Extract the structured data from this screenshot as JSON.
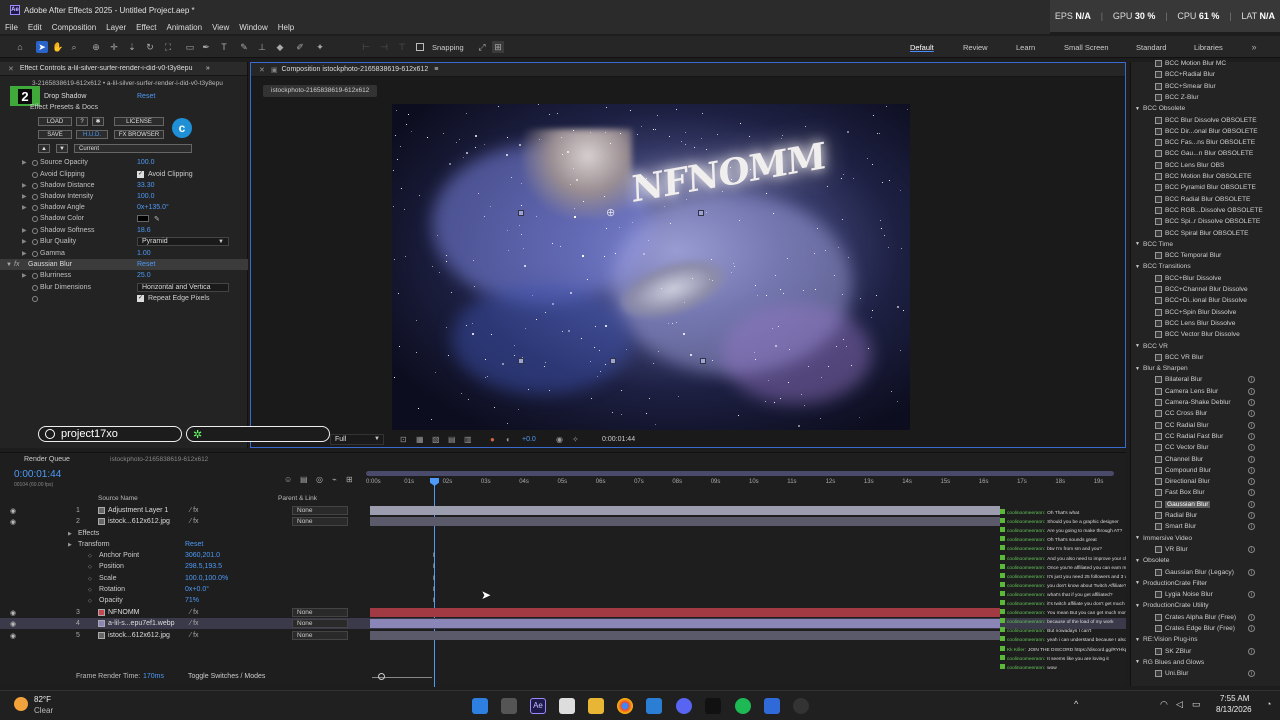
{
  "app": {
    "logo": "Ae",
    "title": "Adobe After Effects 2025 - Untitled Project.aep *",
    "stats": {
      "fps_label": "EPS",
      "fps_value": "N/A",
      "gpu_label": "GPU",
      "gpu_value": "30 %",
      "cpu_label": "CPU",
      "cpu_value": "61 %",
      "lat_label": "LAT",
      "lat_value": "N/A"
    }
  },
  "menu": [
    "File",
    "Edit",
    "Composition",
    "Layer",
    "Effect",
    "Animation",
    "View",
    "Window",
    "Help"
  ],
  "toolbar": {
    "snapping_label": "Snapping",
    "workspaces": [
      "Default",
      "Review",
      "Learn",
      "Small Screen",
      "Standard",
      "Libraries"
    ],
    "active_workspace": "Default"
  },
  "effect_controls": {
    "tab_title": "Effect Controls a-lil-silver-surfer-render-i-did-v0-t3y8epu",
    "subtitle": "a-lil-silver-surfer-render-i-did-v0-t3y8epu",
    "layer_ref": "3-2165838619-612x612 • a-lil-silver-surfer-render-i-did-v0-t3y8epu",
    "badge": "2",
    "drop_shadow": "Drop Shadow",
    "reset": "Reset",
    "presets": "Effect Presets & Docs",
    "buttons": {
      "load": "LOAD",
      "help": "?",
      "license": "LICENSE",
      "save": "SAVE",
      "hud": "H.U.D.",
      "browser": "FX BROWSER",
      "current": "Current"
    },
    "properties": [
      {
        "name": "Source Opacity",
        "value": "100.0"
      },
      {
        "name": "Avoid Clipping",
        "value": "Avoid Clipping"
      },
      {
        "name": "Shadow Distance",
        "value": "33.30"
      },
      {
        "name": "Shadow Intensity",
        "value": "100.0"
      },
      {
        "name": "Shadow Angle",
        "value": "0x+135.0°"
      },
      {
        "name": "Shadow Color",
        "value": ""
      },
      {
        "name": "Shadow Softness",
        "value": "18.6"
      },
      {
        "name": "Blur Quality",
        "value": "Pyramid"
      },
      {
        "name": "Gamma",
        "value": "1.00"
      }
    ],
    "gaussian": {
      "name": "Gaussian Blur",
      "reset": "Reset",
      "blurriness_label": "Blurriness",
      "blurriness": "25.0",
      "dimensions_label": "Blur Dimensions",
      "dimensions": "Horizontal and Vertica",
      "repeat": "Repeat Edge Pixels"
    }
  },
  "composition": {
    "tab_title": "Composition istockphoto-2165838619-612x612",
    "sub_tab": "istockphoto-2165838619-612x612",
    "viewer_text": "NFNOMM",
    "zoom": "Full",
    "timecode": "0:00:01:44",
    "exposure": "+0.0"
  },
  "stream_overlay": {
    "handle": "project17xo"
  },
  "fx_browser": [
    {
      "label": "BCC Motion Blur MC",
      "kind": "item"
    },
    {
      "label": "BCC+Radial Blur",
      "kind": "item"
    },
    {
      "label": "BCC+Smear Blur",
      "kind": "item"
    },
    {
      "label": "BCC Z-Blur",
      "kind": "item"
    },
    {
      "label": "BCC Obsolete",
      "kind": "cat"
    },
    {
      "label": "BCC Blur Dissolve OBSOLETE",
      "kind": "item"
    },
    {
      "label": "BCC Dir...onal Blur OBSOLETE",
      "kind": "item"
    },
    {
      "label": "BCC Fas...ns Blur OBSOLETE",
      "kind": "item"
    },
    {
      "label": "BCC Gau...n Blur OBSOLETE",
      "kind": "item"
    },
    {
      "label": "BCC Lens Blur OBS",
      "kind": "item"
    },
    {
      "label": "BCC Motion Blur OBSOLETE",
      "kind": "item"
    },
    {
      "label": "BCC Pyramid Blur OBSOLETE",
      "kind": "item"
    },
    {
      "label": "BCC Radial Blur OBSOLETE",
      "kind": "item"
    },
    {
      "label": "BCC RGB...Dissolve OBSOLETE",
      "kind": "item"
    },
    {
      "label": "BCC Spi..r Dissolve OBSOLETE",
      "kind": "item"
    },
    {
      "label": "BCC Spiral Blur OBSOLETE",
      "kind": "item"
    },
    {
      "label": "BCC Time",
      "kind": "cat"
    },
    {
      "label": "BCC Temporal Blur",
      "kind": "item"
    },
    {
      "label": "BCC Transitions",
      "kind": "cat"
    },
    {
      "label": "BCC+Blur Dissolve",
      "kind": "item"
    },
    {
      "label": "BCC+Channel Blur Dissolve",
      "kind": "item"
    },
    {
      "label": "BCC+Di..ional Blur Dissolve",
      "kind": "item"
    },
    {
      "label": "BCC+Spin Blur Dissolve",
      "kind": "item"
    },
    {
      "label": "BCC Lens Blur Dissolve",
      "kind": "item"
    },
    {
      "label": "BCC Vector Blur Dissolve",
      "kind": "item"
    },
    {
      "label": "BCC VR",
      "kind": "cat"
    },
    {
      "label": "BCC VR Blur",
      "kind": "item"
    },
    {
      "label": "Blur & Sharpen",
      "kind": "cat"
    },
    {
      "label": "Bilateral Blur",
      "kind": "item"
    },
    {
      "label": "Camera Lens Blur",
      "kind": "item"
    },
    {
      "label": "Camera-Shake Deblur",
      "kind": "item"
    },
    {
      "label": "CC Cross Blur",
      "kind": "item"
    },
    {
      "label": "CC Radial Blur",
      "kind": "item"
    },
    {
      "label": "CC Radial Fast Blur",
      "kind": "item"
    },
    {
      "label": "CC Vector Blur",
      "kind": "item"
    },
    {
      "label": "Channel Blur",
      "kind": "item"
    },
    {
      "label": "Compound Blur",
      "kind": "item"
    },
    {
      "label": "Directional Blur",
      "kind": "item"
    },
    {
      "label": "Fast Box Blur",
      "kind": "item"
    },
    {
      "label": "Gaussian Blur",
      "kind": "sel"
    },
    {
      "label": "Radial Blur",
      "kind": "item"
    },
    {
      "label": "Smart Blur",
      "kind": "item"
    },
    {
      "label": "Immersive Video",
      "kind": "cat"
    },
    {
      "label": "VR Blur",
      "kind": "item"
    },
    {
      "label": "Obsolete",
      "kind": "cat"
    },
    {
      "label": "Gaussian Blur (Legacy)",
      "kind": "item"
    },
    {
      "label": "ProductionCrate Filter",
      "kind": "cat"
    },
    {
      "label": "Lygia Noise Blur",
      "kind": "item"
    },
    {
      "label": "ProductionCrate Utility",
      "kind": "cat"
    },
    {
      "label": "Crates Alpha Blur (Free)",
      "kind": "item"
    },
    {
      "label": "Crates Edge Blur (Free)",
      "kind": "item"
    },
    {
      "label": "RE:Vision Plug-ins",
      "kind": "cat"
    },
    {
      "label": "SK ZBlur",
      "kind": "item"
    },
    {
      "label": "RG Blues and Glows",
      "kind": "cat"
    },
    {
      "label": "Uni.Blur",
      "kind": "item"
    }
  ],
  "timeline": {
    "comp_tab": "Render Queue",
    "comp_tab2": "istockphoto-2165838619-612x612",
    "timecode": "0:00:01:44",
    "frame_info": "00104 (60.00 fps)",
    "col_source": "Source Name",
    "col_parent": "Parent & Link",
    "ruler": [
      "0:00s",
      "01s",
      "02s",
      "03s",
      "04s",
      "05s",
      "06s",
      "07s",
      "08s",
      "09s",
      "10s",
      "11s",
      "12s",
      "13s",
      "14s",
      "15s",
      "16s",
      "17s",
      "18s",
      "19s"
    ],
    "layers": [
      {
        "num": "1",
        "name": "Adjustment Layer 1",
        "parent": "None"
      },
      {
        "num": "2",
        "name": "istock...612x612.jpg",
        "parent": "None"
      },
      {
        "num": "",
        "name": "Effects",
        "parent": ""
      },
      {
        "num": "",
        "name": "Transform",
        "parent": "",
        "value": "Reset"
      },
      {
        "num": "",
        "name": "Anchor Point",
        "parent": "",
        "value": "3060,201.0"
      },
      {
        "num": "",
        "name": "Position",
        "parent": "",
        "value": "298.5,193.5"
      },
      {
        "num": "",
        "name": "Scale",
        "parent": "",
        "value": "100.0,100.0%"
      },
      {
        "num": "",
        "name": "Rotation",
        "parent": "",
        "value": "0x+0.0°"
      },
      {
        "num": "",
        "name": "Opacity",
        "parent": "",
        "value": "71%"
      },
      {
        "num": "3",
        "name": "NFNOMM",
        "parent": "None"
      },
      {
        "num": "4",
        "name": "a-lil-s...epu7ef1.webp",
        "parent": "None"
      },
      {
        "num": "5",
        "name": "istock...612x612.jpg",
        "parent": "None"
      }
    ],
    "footer_left": "Frame Render Time:",
    "footer_time": "170ms",
    "footer_toggle": "Toggle Switches / Modes"
  },
  "chat": [
    {
      "user": "coolinoomeerann:",
      "msg": "Oh That's what"
    },
    {
      "user": "coolinoomeerann:",
      "msg": "Should you be a graphic designer"
    },
    {
      "user": "coolinoomeerann:",
      "msg": "Are you going to make through AT?"
    },
    {
      "user": "coolinoomeerann:",
      "msg": "Oh That's sounds great"
    },
    {
      "user": "coolinoomeerann:",
      "msg": "btw I'm from sm and you?"
    },
    {
      "user": "coolinoomeerann:",
      "msg": "And you also need to improve your channel"
    },
    {
      "user": "coolinoomeerann:",
      "msg": "Once you're affiliated you can earn more"
    },
    {
      "user": "coolinoomeerann:",
      "msg": "It's just you need 25 followers and 3 viewers"
    },
    {
      "user": "coolinoomeerann:",
      "msg": "you don't know about Twitch Affiliate?"
    },
    {
      "user": "coolinoomeerann:",
      "msg": "what's that if you get affiliated?"
    },
    {
      "user": "coolinoomeerann:",
      "msg": "it's twitch affiliate you don't get much money"
    },
    {
      "user": "coolinoomeerann:",
      "msg": "You mean But you can get much more"
    },
    {
      "user": "coolinoomeerann:",
      "msg": "because of the load of my work"
    },
    {
      "user": "coolinoomeerann:",
      "msg": "But nowadays I can't"
    },
    {
      "user": "coolinoomeerann:",
      "msg": "yeah i can understand because I also create"
    },
    {
      "user": "Kk Killer:",
      "msg": "JOIN THE DISCORD https://discord.gg/RYHkpNqqs"
    },
    {
      "user": "coolinoomeerann:",
      "msg": "It seems like you are loving it"
    },
    {
      "user": "coolinoomeerann:",
      "msg": "wow"
    }
  ],
  "taskbar": {
    "weather_temp": "82°F",
    "weather_desc": "Clear",
    "time": "7:55 AM",
    "date": "8/13/2026"
  },
  "colors": {
    "accent": "#2a63c9",
    "link_value": "#4e9af6",
    "chat_user": "#66c659",
    "layer_red": "#a23a44",
    "layer_purple": "#8a86b8"
  }
}
